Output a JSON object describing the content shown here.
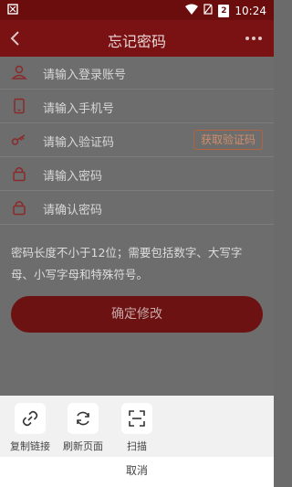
{
  "status_bar": {
    "time": "10:24",
    "battery": "2"
  },
  "appbar": {
    "title": "忘记密码"
  },
  "fields": [
    {
      "icon": "user-icon",
      "placeholder": "请输入登录账号"
    },
    {
      "icon": "phone-icon",
      "placeholder": "请输入手机号"
    },
    {
      "icon": "key-icon",
      "placeholder": "请输入验证码",
      "button": "获取验证码"
    },
    {
      "icon": "lock-icon",
      "placeholder": "请输入密码"
    },
    {
      "icon": "lock-icon",
      "placeholder": "请确认密码"
    }
  ],
  "hint": "密码长度不小于12位；需要包括数字、大写字母、小写字母和特殊符号。",
  "confirm_label": "确定修改",
  "share_sheet": {
    "actions": [
      {
        "icon": "link-icon",
        "label": "复制链接"
      },
      {
        "icon": "refresh-icon",
        "label": "刷新页面"
      },
      {
        "icon": "scan-icon",
        "label": "扫描"
      }
    ],
    "cancel_label": "取消"
  },
  "colors": {
    "status_bar": "#6b0c0d",
    "app_bar": "#7a1113",
    "overlay_bg": "#6d6d6d",
    "accent_button": "#6c1213",
    "code_button_border": "#b5623d"
  }
}
